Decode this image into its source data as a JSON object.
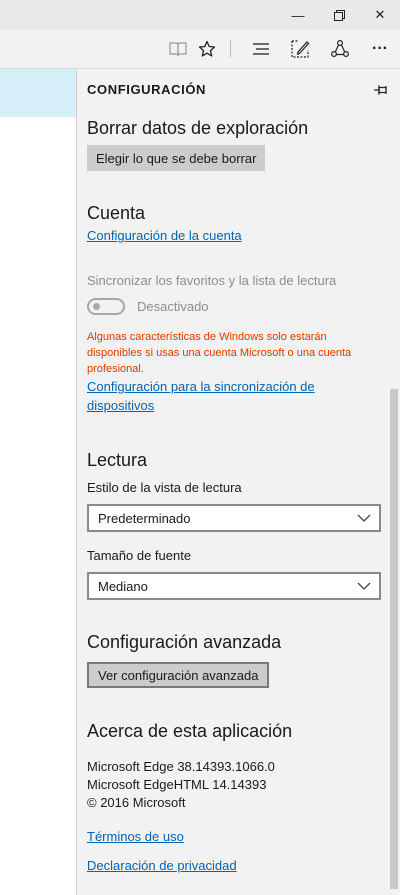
{
  "window": {
    "minimize_glyph": "—",
    "restore_glyph": "❐",
    "close_glyph": "✕"
  },
  "toolbar": {
    "icons": [
      "reading-view-icon",
      "favorites-star-icon",
      "hub-icon",
      "web-note-icon",
      "share-icon",
      "more-icon"
    ],
    "more_glyph": "···"
  },
  "panel": {
    "title": "CONFIGURACIÓN",
    "clear_data": {
      "heading": "Borrar datos de exploración",
      "button": "Elegir lo que se debe borrar"
    },
    "account": {
      "heading": "Cuenta",
      "link": "Configuración de la cuenta",
      "sync_label": "Sincronizar los favoritos y la lista de lectura",
      "toggle_state": "Desactivado",
      "toggle_on": false,
      "warning": "Algunas características de Windows solo estarán disponibles si usas una cuenta Microsoft o una cuenta profesional.",
      "sync_link": "Configuración para la sincronización de dispositivos"
    },
    "reading": {
      "heading": "Lectura",
      "style_label": "Estilo de la vista de lectura",
      "style_value": "Predeterminado",
      "font_label": "Tamaño de fuente",
      "font_value": "Mediano"
    },
    "advanced": {
      "heading": "Configuración avanzada",
      "button": "Ver configuración avanzada"
    },
    "about": {
      "heading": "Acerca de esta aplicación",
      "edge_version": "Microsoft Edge 38.14393.1066.0",
      "edgehtml_version": "Microsoft EdgeHTML 14.14393",
      "copyright": "© 2016 Microsoft",
      "terms_link": "Términos de uso",
      "privacy_link": "Declaración de privacidad"
    }
  },
  "colors": {
    "accent_link": "#0063b1",
    "warning": "#d83b01",
    "panel_bg": "#f2f2f2"
  }
}
